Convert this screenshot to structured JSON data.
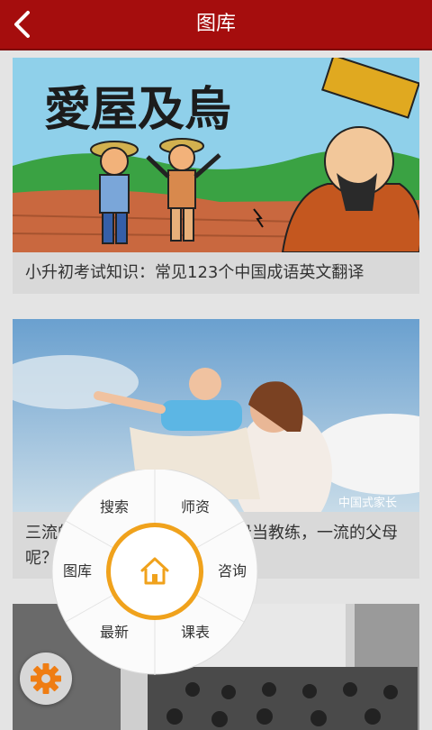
{
  "header": {
    "title": "图库",
    "back_icon": "back-arrow-icon"
  },
  "articles": [
    {
      "caption": "小升初考试知识：常见123个中国成语英文翻译",
      "image_title": "愛屋及烏"
    },
    {
      "caption_line1": "三流的父母当保姆，二流的父母当教练，一流的父母",
      "caption_line2": "呢？",
      "watermark": "中国式家长"
    },
    {
      "caption": ""
    }
  ],
  "radial_menu": {
    "items": [
      "搜索",
      "师资",
      "咨询",
      "课表",
      "最新",
      "图库"
    ],
    "center_icon": "home-icon",
    "accent_color": "#f0a21c"
  },
  "settings_button": {
    "icon": "gear-icon",
    "color": "#ef7d13"
  },
  "colors": {
    "header": "#a50d0d",
    "background": "#e4e4e4"
  }
}
